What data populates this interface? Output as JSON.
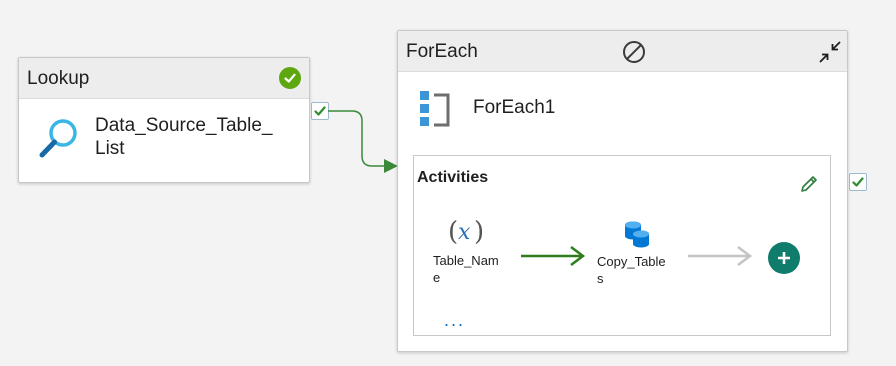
{
  "lookup": {
    "title": "Lookup",
    "name_line1": "Data_Source_Table_",
    "name_line2": "List",
    "status": "success"
  },
  "foreach": {
    "title": "ForEach",
    "name": "ForEach1",
    "activities": {
      "title": "Activities",
      "items": [
        {
          "icon": "variable-icon",
          "label_line1": "Table_Nam",
          "label_line2": "e"
        },
        {
          "icon": "copy-data-icon",
          "label_line1": "Copy_Table",
          "label_line2": "s"
        }
      ],
      "more": "..."
    }
  },
  "colors": {
    "success": "#5ea70f",
    "link_success": "#3a8a3a",
    "add": "#107c6b",
    "icon_blue": "#0f6cbd"
  }
}
